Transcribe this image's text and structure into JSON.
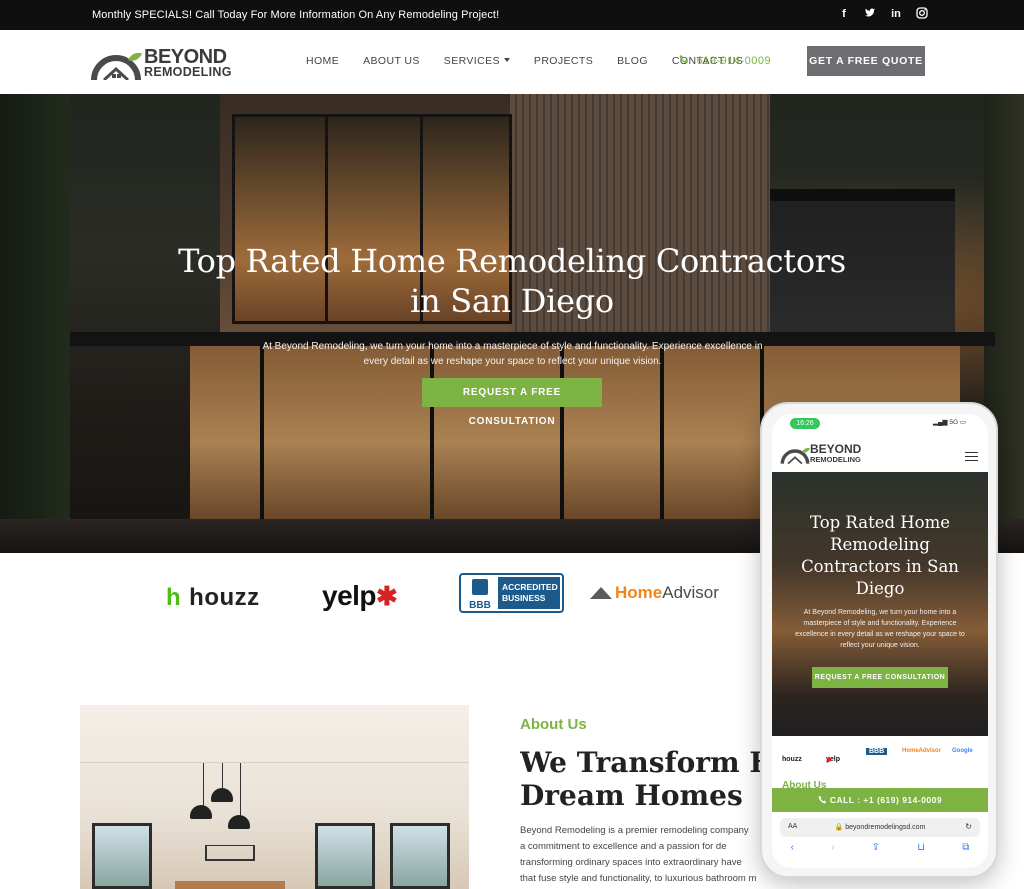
{
  "topbar": {
    "promo": "Monthly SPECIALS! Call Today For More Information On Any Remodeling Project!",
    "socials": [
      {
        "icon": "facebook-icon",
        "glyph": "f"
      },
      {
        "icon": "twitter-icon",
        "glyph": "★"
      },
      {
        "icon": "linkedin-icon",
        "glyph": "in"
      },
      {
        "icon": "instagram-icon",
        "glyph": "◎"
      }
    ]
  },
  "header": {
    "logo_line1": "BEYOND",
    "logo_line2": "REMODELING",
    "nav": [
      "HOME",
      "ABOUT US",
      "SERVICES",
      "PROJECTS",
      "BLOG",
      "CONTACT US"
    ],
    "phone": "619-914-0009",
    "quote_button": "GET A FREE QUOTE"
  },
  "hero": {
    "title_line1": "Top Rated Home Remodeling Contractors",
    "title_line2": "in San Diego",
    "subtitle": "At Beyond Remodeling, we turn your home into a masterpiece of style and functionality. Experience excellence in every detail as we reshape your space to reflect your unique vision.",
    "cta": "REQUEST A FREE CONSULTATION"
  },
  "badges": {
    "houzz": "houzz",
    "yelp": "yelp",
    "bbb_seal": "BBB",
    "bbb_line1": "ACCREDITED",
    "bbb_line2": "BUSINESS",
    "homeadvisor_home": "Home",
    "homeadvisor_advisor": "Advisor"
  },
  "about": {
    "eyebrow": "About Us",
    "title_line1": "We Transform Ho",
    "title_line2": "Dream Homes",
    "text_lines": [
      "Beyond Remodeling is a premier remodeling company",
      "a commitment to excellence and a passion for de",
      "transforming ordinary spaces into extraordinary have",
      "that fuse style and functionality, to luxurious bathroom m"
    ]
  },
  "mobile": {
    "time": "16:26",
    "signal": "5G",
    "logo_line1": "BEYOND",
    "logo_line2": "REMODELING",
    "hero_title": "Top Rated Home Remodeling Contractors in San Diego",
    "hero_subtitle": "At Beyond Remodeling, we turn your home into a masterpiece of style and functionality. Experience excellence in every detail as we reshape your space to reflect your unique vision.",
    "hero_cta": "REQUEST A FREE CONSULTATION",
    "badges": [
      "houzz",
      "yelp",
      "BBB",
      "HomeAdvisor",
      "Google"
    ],
    "about_peek": "About Us",
    "call_bar": "CALL : +1 (619) 914-0009",
    "url_aa": "AA",
    "url": "beyondremodelingsd.com",
    "toolbar": [
      "back-icon",
      "forward-icon",
      "share-icon",
      "bookmarks-icon",
      "tabs-icon"
    ]
  },
  "colors": {
    "accent_green": "#7cb342",
    "topbar_bg": "#0f0f0f",
    "quote_btn": "#6d6e71"
  }
}
